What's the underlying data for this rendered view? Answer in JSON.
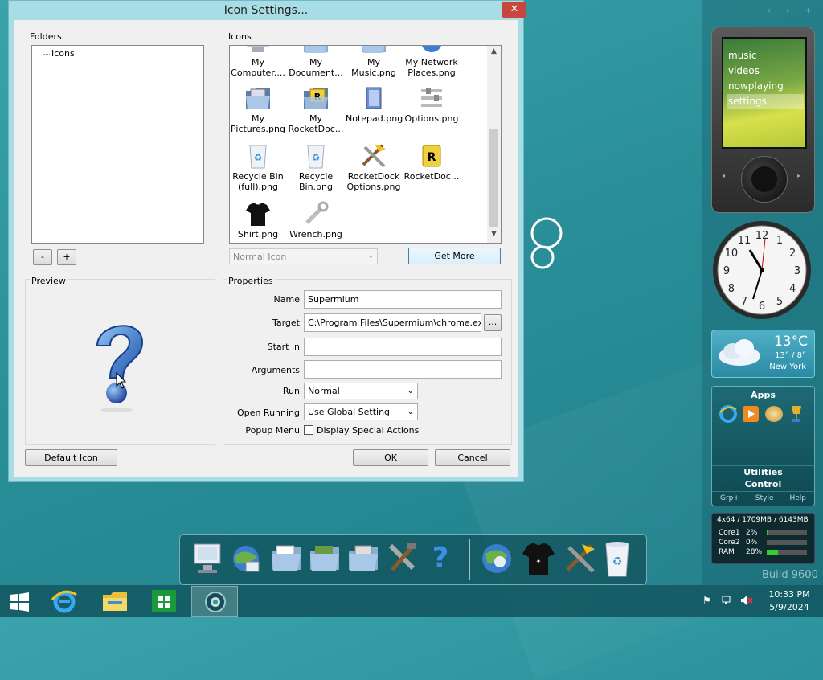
{
  "dialog": {
    "title": "Icon Settings...",
    "close": "✕",
    "folders_label": "Folders",
    "tree_root": "Icons",
    "remove_btn": "-",
    "add_btn": "+",
    "icons_label": "Icons",
    "icons": [
      {
        "label": "My\nComputer....",
        "icon": "computer-icon"
      },
      {
        "label": "My\nDocument...",
        "icon": "documents-folder-icon"
      },
      {
        "label": "My Music.png",
        "icon": "music-folder-icon"
      },
      {
        "label": "My Network\nPlaces.png",
        "icon": "network-icon"
      },
      {
        "label": "My\nPictures.png",
        "icon": "pictures-folder-icon"
      },
      {
        "label": "My\nRocketDoc...",
        "icon": "rocketdock-folder-icon"
      },
      {
        "label": "Notepad.png",
        "icon": "notepad-icon"
      },
      {
        "label": "Options.png",
        "icon": "options-icon"
      },
      {
        "label": "Recycle Bin\n(full).png",
        "icon": "recycle-bin-full-icon"
      },
      {
        "label": "Recycle\nBin.png",
        "icon": "recycle-bin-icon"
      },
      {
        "label": "RocketDock\nOptions.png",
        "icon": "rocketdock-options-icon"
      },
      {
        "label": "RocketDoc...",
        "icon": "rocketdock-icon"
      },
      {
        "label": "Shirt.png",
        "icon": "shirt-icon"
      },
      {
        "label": "Wrench.png",
        "icon": "wrench-icon"
      }
    ],
    "icon_type_select": "Normal Icon",
    "get_more_btn": "Get More",
    "preview_label": "Preview",
    "properties_label": "Properties",
    "name_label": "Name",
    "name_value": "Supermium",
    "target_label": "Target",
    "target_value": "C:\\Program Files\\Supermium\\chrome.exe",
    "browse_btn": "...",
    "startin_label": "Start in",
    "startin_value": "",
    "arguments_label": "Arguments",
    "arguments_value": "",
    "run_label": "Run",
    "run_value": "Normal",
    "openrunning_label": "Open Running",
    "openrunning_value": "Use Global Setting",
    "popup_label": "Popup Menu",
    "popup_checkbox_label": "Display Special Actions",
    "default_icon_btn": "Default Icon",
    "ok_btn": "OK",
    "cancel_btn": "Cancel"
  },
  "zune": {
    "items": [
      "music",
      "videos",
      "nowplaying",
      "settings"
    ],
    "selected": "settings"
  },
  "weather": {
    "temp": "13°C",
    "range": "13° / 8°",
    "city": "New York"
  },
  "apps_gadget": {
    "title": "Apps",
    "utilities": "Utilities",
    "control": "Control",
    "footer": [
      "Grp+",
      "Style",
      "Help"
    ]
  },
  "cpu_gadget": {
    "header": "4x64 / 1709MB / 6143MB",
    "rows": [
      {
        "name": "Core1",
        "pct": "2%",
        "fill": 0.02
      },
      {
        "name": "Core2",
        "pct": "0%",
        "fill": 0.0
      },
      {
        "name": "RAM",
        "pct": "28%",
        "fill": 0.28
      }
    ]
  },
  "build": "Build 9600",
  "clock": {
    "time": "10:33 PM",
    "date": "5/9/2024"
  },
  "colors": {
    "accent": "#a9dde6",
    "desktop": "#2a8f99",
    "close": "#c7463d"
  }
}
